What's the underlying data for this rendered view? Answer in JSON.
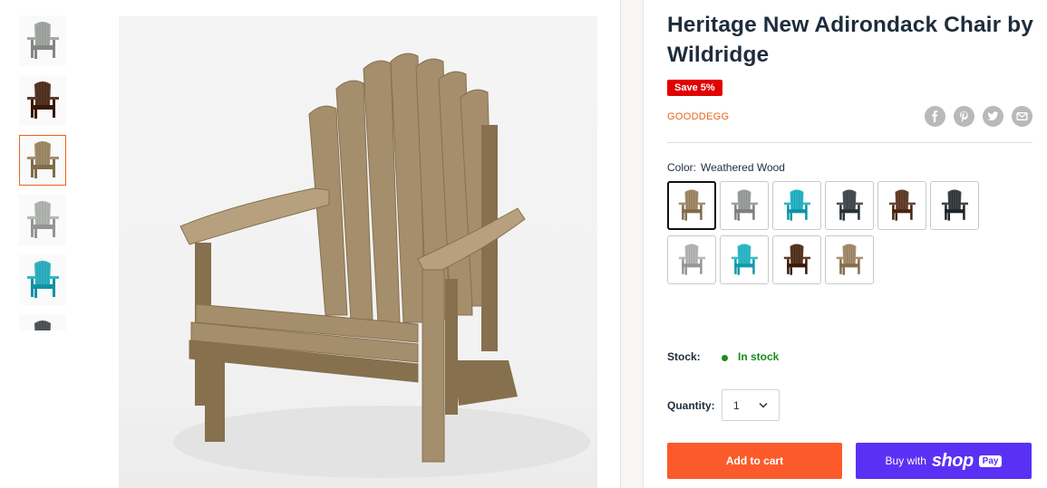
{
  "gallery": {
    "thumbnails": [
      {
        "name": "thumb-gray",
        "color": "#a6aaa6"
      },
      {
        "name": "thumb-brown",
        "color": "#5b3a28"
      },
      {
        "name": "thumb-weathered",
        "color": "#a38f6d"
      },
      {
        "name": "thumb-light-gray",
        "color": "#b6b8b5"
      },
      {
        "name": "thumb-aqua",
        "color": "#34b5c6"
      },
      {
        "name": "thumb-dark-gray",
        "color": "#545a5e"
      }
    ],
    "active_index": 2,
    "main_color": "#a48e6c"
  },
  "product": {
    "title": "Heritage New Adirondack Chair by Wildridge",
    "badge": "Save 5%",
    "vendor": "GOODDEGG"
  },
  "share": [
    "facebook-icon",
    "pinterest-icon",
    "twitter-icon",
    "email-icon"
  ],
  "color": {
    "label": "Color:",
    "value": "Weathered Wood",
    "swatches": [
      {
        "name": "weathered-wood",
        "color": "#a48e6c",
        "selected": true
      },
      {
        "name": "gray",
        "color": "#9fa3a0"
      },
      {
        "name": "aqua",
        "color": "#2eb7c8"
      },
      {
        "name": "dark-gray",
        "color": "#4d5458"
      },
      {
        "name": "brown",
        "color": "#6b4632"
      },
      {
        "name": "black-gray",
        "color": "#40464a"
      },
      {
        "name": "light-gray",
        "color": "#b8bab7"
      },
      {
        "name": "aqua-2",
        "color": "#35bccc"
      },
      {
        "name": "chestnut",
        "color": "#5e3c2a"
      },
      {
        "name": "weathered-2",
        "color": "#a79170"
      }
    ]
  },
  "stock": {
    "label": "Stock:",
    "value": "In stock"
  },
  "quantity": {
    "label": "Quantity:",
    "value": "1"
  },
  "buttons": {
    "add_to_cart": "Add to cart",
    "buy_with": "Buy with",
    "shop_word": "shop",
    "pay_word": "Pay"
  },
  "colors": {
    "accent": "#fb5b2b",
    "shop_pay": "#5a31f4",
    "in_stock": "#1c8a1c",
    "badge": "#e00000"
  }
}
